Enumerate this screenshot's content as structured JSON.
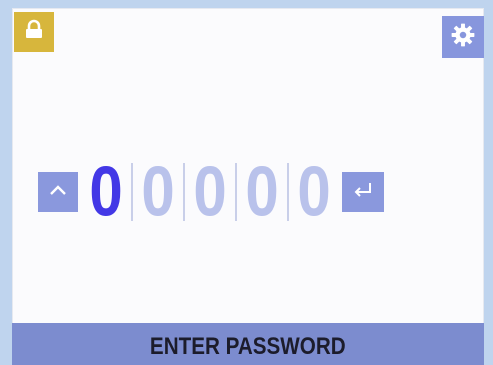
{
  "header": {
    "lock_icon": "lock-icon",
    "settings_icon": "gear-icon"
  },
  "password": {
    "up_icon": "chevron-up-icon",
    "digits": [
      "0",
      "0",
      "0",
      "0",
      "0"
    ],
    "active_index": 0,
    "enter_icon": "enter-return-icon"
  },
  "status": {
    "label": "ENTER PASSWORD"
  },
  "colors": {
    "lock_button": "#d7b63c",
    "accent_button": "#8a98dd",
    "active_digit": "#4338e6",
    "inactive_digit": "#b9c2eb",
    "status_bar": "#7c8ccf"
  }
}
